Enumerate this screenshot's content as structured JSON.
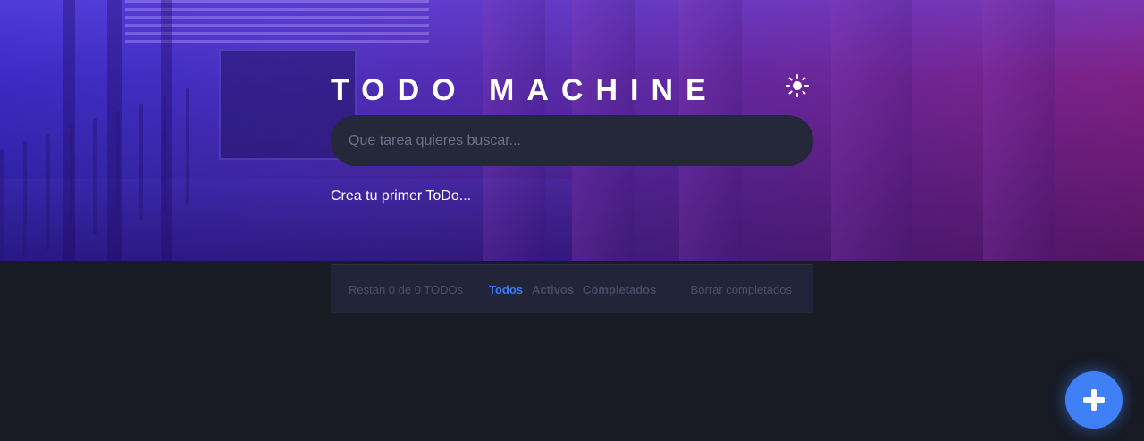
{
  "header": {
    "title": "TODO MACHINE",
    "theme_icon": "sun-icon"
  },
  "search": {
    "placeholder": "Que tarea quieres buscar...",
    "value": ""
  },
  "empty_message": "Crea tu primer ToDo...",
  "footer": {
    "count_text": "Restan 0 de 0 TODOs",
    "filters": [
      {
        "label": "Todos",
        "active": true
      },
      {
        "label": "Activos",
        "active": false
      },
      {
        "label": "Completados",
        "active": false
      }
    ],
    "clear_label": "Borrar completados"
  },
  "fab": {
    "icon": "plus-icon"
  },
  "colors": {
    "accent": "#3a7bfd",
    "fab": "#3f80f6",
    "background": "#181a24",
    "panel": "#22253a"
  }
}
